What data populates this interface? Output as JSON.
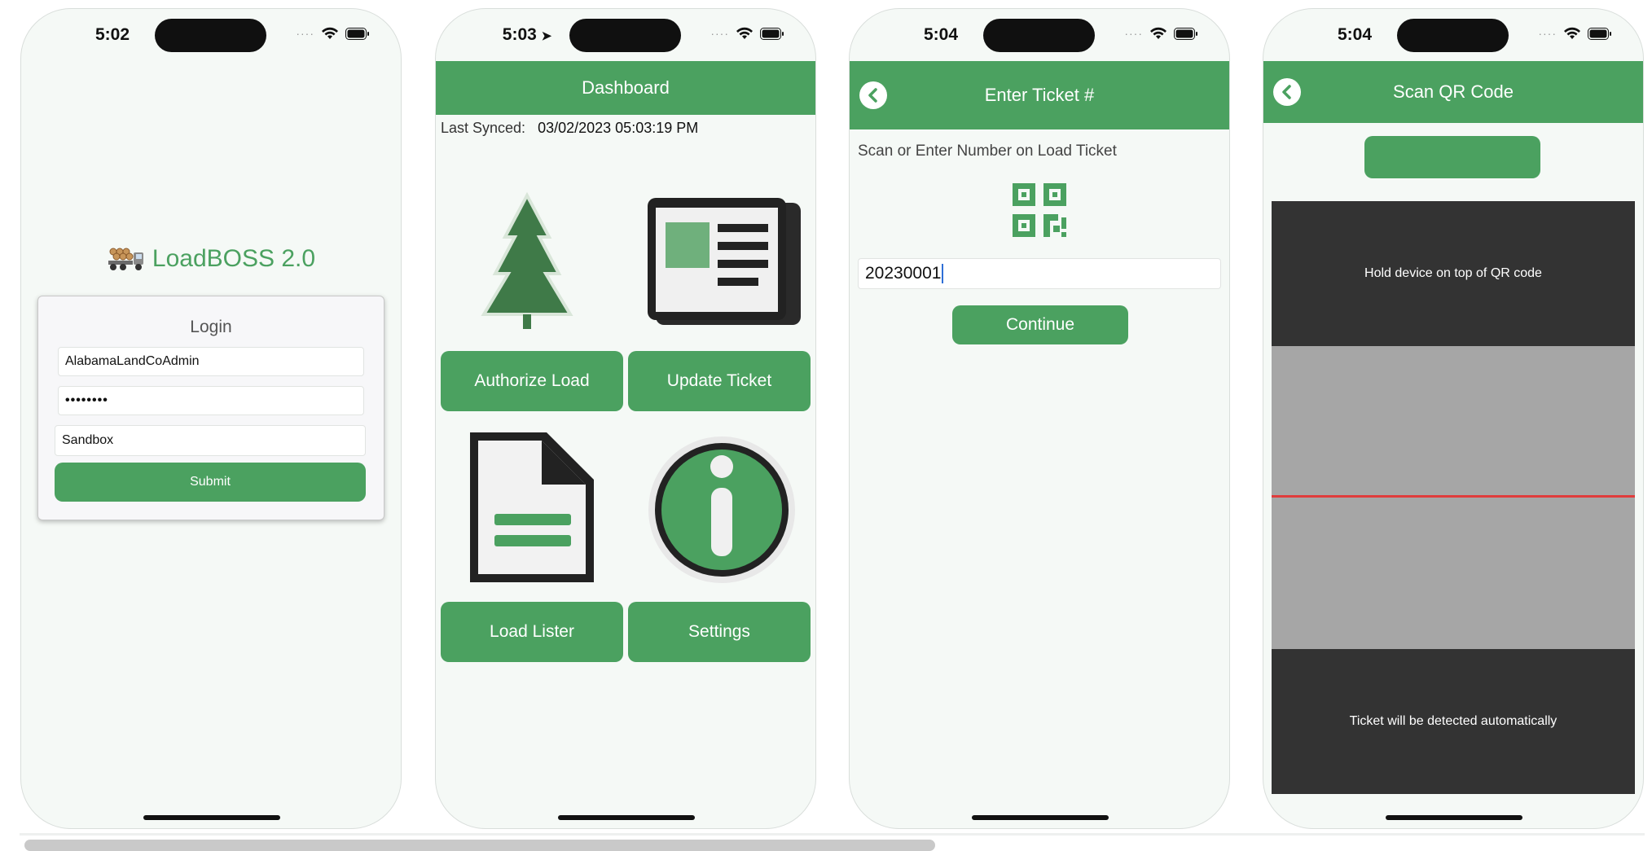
{
  "colors": {
    "brand_green": "#4ba160",
    "background": "#f5f9f6",
    "scanner_dark": "#333333",
    "scanner_mid": "#a6a6a6",
    "scan_line": "#e03c3c"
  },
  "screens": {
    "login": {
      "time": "5:02",
      "app_name": "LoadBOSS 2.0",
      "app_icon": "logging-truck-icon",
      "card_title": "Login",
      "username": "AlabamaLandCoAdmin",
      "password": "••••••••",
      "environment": "Sandbox",
      "submit_label": "Submit"
    },
    "dashboard": {
      "time": "5:03",
      "title": "Dashboard",
      "last_synced_label": "Last Synced:",
      "last_synced_value": "03/02/2023 05:03:19 PM",
      "tiles": [
        {
          "label": "Authorize Load",
          "icon": "pine-tree-icon"
        },
        {
          "label": "Update Ticket",
          "icon": "newspaper-icon"
        },
        {
          "label": "Load Lister",
          "icon": "document-icon"
        },
        {
          "label": "Settings",
          "icon": "info-icon"
        }
      ]
    },
    "enter_ticket": {
      "time": "5:04",
      "title": "Enter Ticket #",
      "instruction": "Scan or Enter Number on Load Ticket",
      "ticket_value": "20230001",
      "continue_label": "Continue"
    },
    "scan_qr": {
      "time": "5:04",
      "title": "Scan QR Code",
      "top_hint": "Hold device on top of QR code",
      "bottom_hint": "Ticket will be detected automatically"
    }
  }
}
